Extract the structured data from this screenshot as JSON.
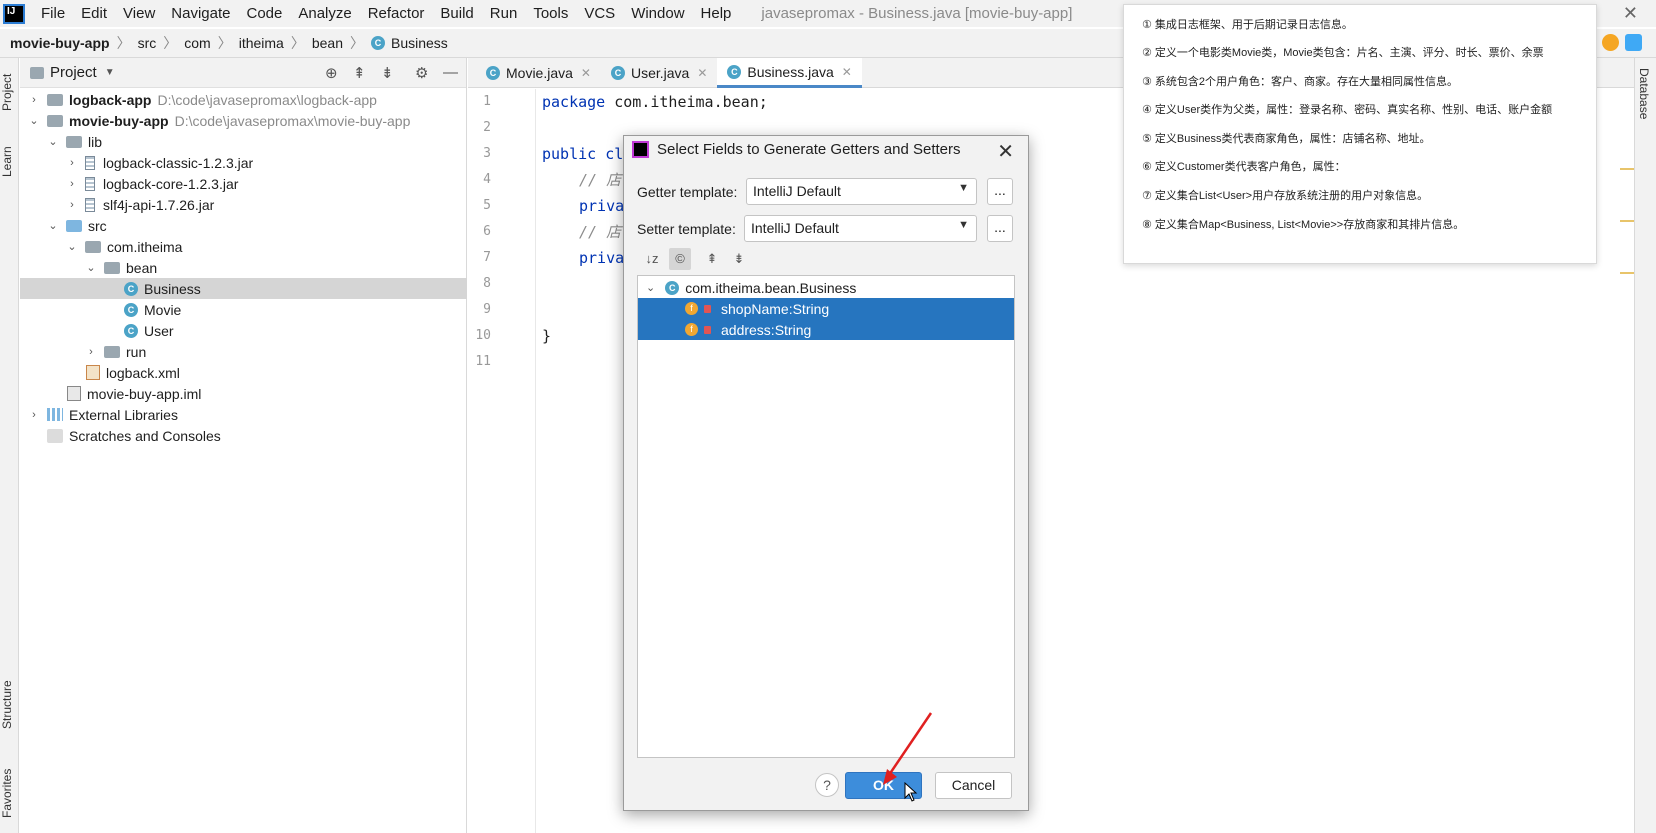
{
  "menubar": {
    "items": [
      {
        "label": "File",
        "mnemonic": "F",
        "rest": "ile"
      },
      {
        "label": "Edit",
        "mnemonic": "E",
        "rest": "dit"
      },
      {
        "label": "View",
        "mnemonic": "V",
        "rest": "iew"
      },
      {
        "label": "Navigate",
        "mnemonic": "N",
        "rest": "avigate"
      },
      {
        "label": "Code",
        "mnemonic": "C",
        "rest": "ode"
      },
      {
        "label": "Analyze",
        "mnemonic": "",
        "rest": "Analyze"
      },
      {
        "label": "Refactor",
        "mnemonic": "R",
        "rest": "efactor"
      },
      {
        "label": "Build",
        "mnemonic": "B",
        "rest": "uild"
      },
      {
        "label": "Run",
        "mnemonic": "R",
        "rest": "un"
      },
      {
        "label": "Tools",
        "mnemonic": "T",
        "rest": "ools"
      },
      {
        "label": "VCS",
        "mnemonic": "",
        "rest": "VCS"
      },
      {
        "label": "Window",
        "mnemonic": "W",
        "rest": "indow"
      },
      {
        "label": "Help",
        "mnemonic": "H",
        "rest": "elp"
      }
    ],
    "window_title": "javasepromax - Business.java [movie-buy-app]"
  },
  "breadcrumb": {
    "project": "movie-buy-app",
    "parts": [
      "src",
      "com",
      "itheima",
      "bean"
    ],
    "file": "Business"
  },
  "left_strip": {
    "project": "Project",
    "learn": "Learn",
    "structure": "Structure",
    "favorites": "Favorites"
  },
  "right_strip": {
    "database": "Database"
  },
  "project_panel": {
    "title": "Project",
    "tree": [
      {
        "label": "logback-app",
        "path": "D:\\code\\javasepromax\\logback-app"
      },
      {
        "label": "movie-buy-app",
        "path": "D:\\code\\javasepromax\\movie-buy-app"
      },
      {
        "label": "lib"
      },
      {
        "label": "logback-classic-1.2.3.jar"
      },
      {
        "label": "logback-core-1.2.3.jar"
      },
      {
        "label": "slf4j-api-1.7.26.jar"
      },
      {
        "label": "src"
      },
      {
        "label": "com.itheima"
      },
      {
        "label": "bean"
      },
      {
        "label": "Business"
      },
      {
        "label": "Movie"
      },
      {
        "label": "User"
      },
      {
        "label": "run"
      },
      {
        "label": "logback.xml"
      },
      {
        "label": "movie-buy-app.iml"
      },
      {
        "label": "External Libraries"
      },
      {
        "label": "Scratches and Consoles"
      }
    ]
  },
  "editor": {
    "tabs": [
      "Movie.java",
      "User.java",
      "Business.java"
    ],
    "line_numbers": [
      "1",
      "2",
      "3",
      "4",
      "5",
      "6",
      "7",
      "8",
      "9",
      "10",
      "11"
    ],
    "code": {
      "l1_kw": "package",
      "l1_rest": " com.itheima.bean;",
      "l3_kw": "public cl",
      "l4": "// 店",
      "l5": "priva",
      "l6": "// 店",
      "l7": "priva",
      "l10": "}"
    }
  },
  "dialog": {
    "title": "Select Fields to Generate Getters and Setters",
    "getter_label": "Getter template:",
    "getter_value": "IntelliJ Default",
    "setter_label": "Setter template:",
    "setter_value": "IntelliJ Default",
    "dots": "...",
    "tree_root": "com.itheima.bean.Business",
    "fields": [
      "shopName:String",
      "address:String"
    ],
    "help": "?",
    "ok": "OK",
    "cancel": "Cancel"
  },
  "notes": [
    "① 集成日志框架、用于后期记录日志信息。",
    "② 定义一个电影类Movie类，Movie类包含：片名、主演、评分、时长、票价、余票",
    "③ 系统包含2个用户角色：客户、商家。存在大量相同属性信息。",
    "④ 定义User类作为父类，属性：登录名称、密码、真实名称、性别、电话、账户金额",
    "⑤ 定义Business类代表商家角色，属性：店铺名称、地址。",
    "⑥ 定义Customer类代表客户角色，属性：",
    "⑦ 定义集合List<User>用户存放系统注册的用户对象信息。",
    "⑧ 定义集合Map<Business, List<Movie>>存放商家和其排片信息。"
  ]
}
